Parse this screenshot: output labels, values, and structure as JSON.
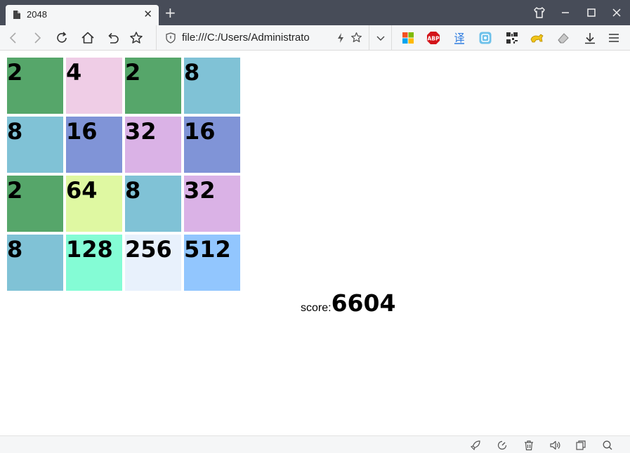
{
  "browser": {
    "tab_title": "2048",
    "tab_close": "✕",
    "new_tab": "+",
    "address_url": "file:///C:/Users/Administrato",
    "extensions": [
      "windows-apps-icon",
      "adblock-plus-icon",
      "translate-icon",
      "screenshot-icon",
      "qr-code-icon",
      "cheetah-icon",
      "eraser-icon"
    ],
    "adblock_label": "ABP",
    "translate_label": "译"
  },
  "game": {
    "board": [
      [
        "2",
        "4",
        "2",
        "8"
      ],
      [
        "8",
        "16",
        "32",
        "16"
      ],
      [
        "2",
        "64",
        "8",
        "32"
      ],
      [
        "8",
        "128",
        "256",
        "512"
      ]
    ],
    "tile_colors": {
      "2": "#56a66a",
      "4": "#efcde6",
      "8": "#80c2d6",
      "16": "#8094d7",
      "32": "#dab2e6",
      "64": "#dff8a2",
      "128": "#84fcd5",
      "256": "#e8f1fc",
      "512": "#92c6fe"
    },
    "score_label": "score:",
    "score_value": "6604"
  }
}
